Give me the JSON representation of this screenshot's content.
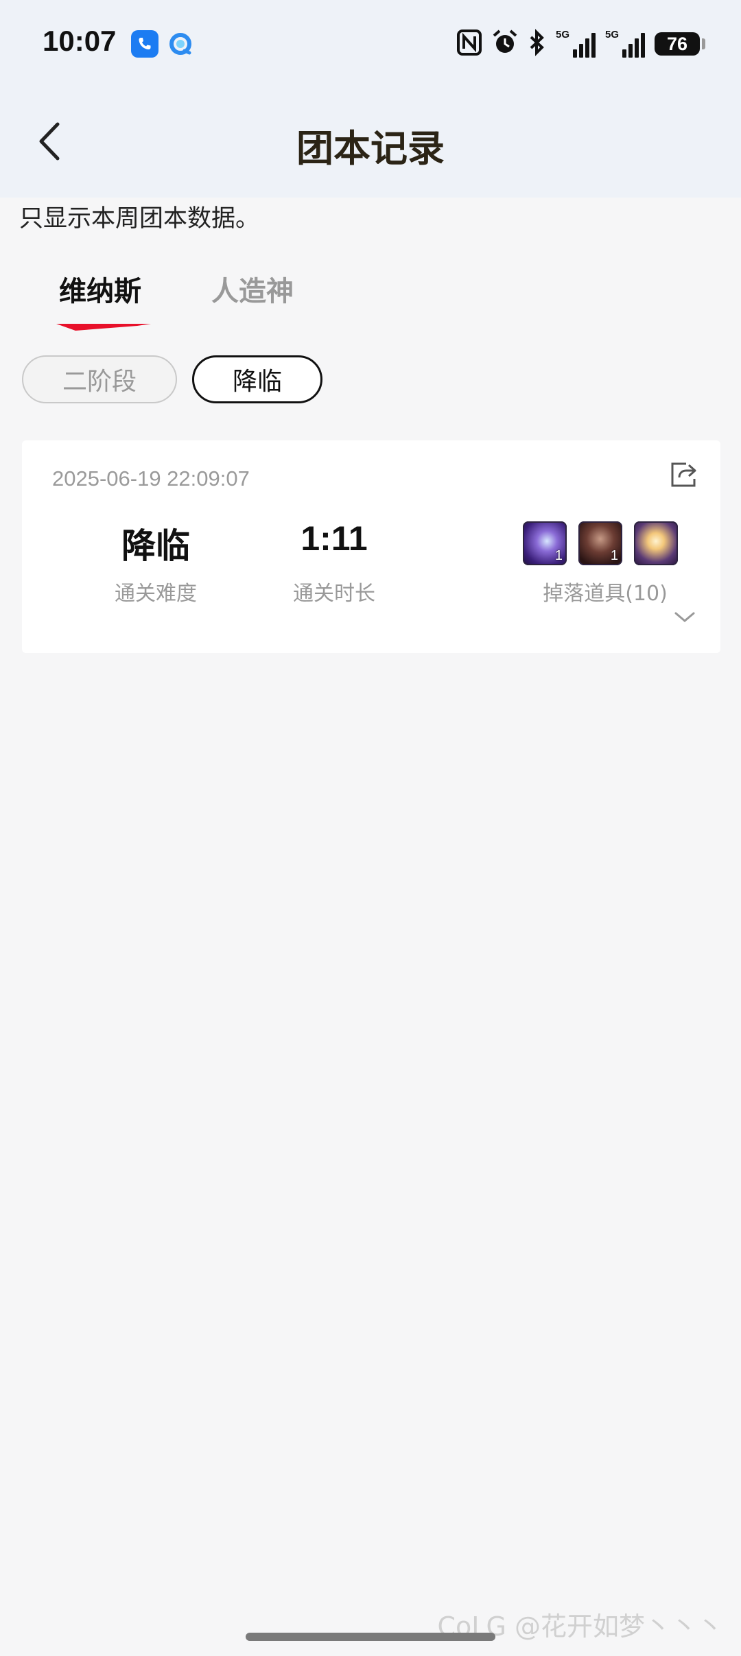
{
  "status_bar": {
    "time": "10:07",
    "app_icons": [
      "phone-icon",
      "browser-icon"
    ],
    "indicators": [
      "nfc-icon",
      "alarm-icon",
      "bluetooth-icon",
      "signal-5g-icon",
      "signal-5g-icon"
    ],
    "network_labels": [
      "5G",
      "5G"
    ],
    "battery": "76"
  },
  "header": {
    "title": "团本记录",
    "back_icon": "chevron-left-icon"
  },
  "notice": "只显示本周团本数据。",
  "tabs": [
    {
      "label": "维纳斯",
      "active": true
    },
    {
      "label": "人造神",
      "active": false
    }
  ],
  "phases": [
    {
      "label": "二阶段",
      "selected": false
    },
    {
      "label": "降临",
      "selected": true
    }
  ],
  "record": {
    "timestamp": "2025-06-19 22:09:07",
    "share_icon": "share-icon",
    "difficulty": {
      "value": "降临",
      "label": "通关难度"
    },
    "duration": {
      "value": "1:11",
      "label": "通关时长"
    },
    "drops": {
      "label": "掉落道具(10)",
      "items": [
        {
          "name": "drop-item-1",
          "qty": "1"
        },
        {
          "name": "drop-item-2",
          "qty": "1"
        },
        {
          "name": "drop-item-3",
          "qty": ""
        }
      ]
    },
    "expand_icon": "chevron-down-icon"
  },
  "watermark": "CoLG @花开如梦丶丶丶",
  "colors": {
    "accent_underline": "#e8102a",
    "header_bg": "#eef2f8",
    "page_bg": "#f6f6f7",
    "title_color": "#2b2416"
  }
}
